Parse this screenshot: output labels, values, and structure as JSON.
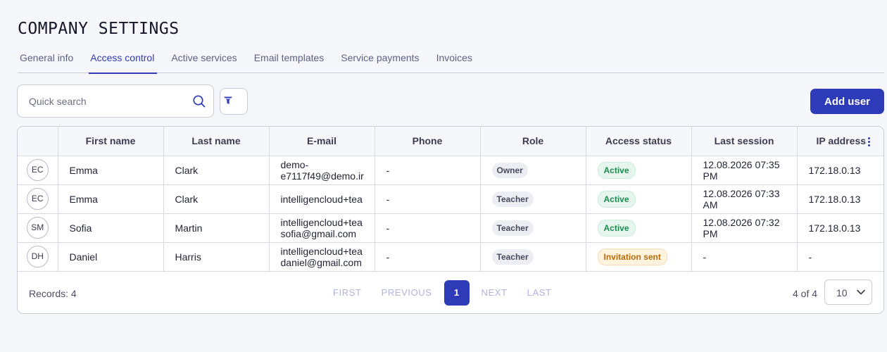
{
  "page_title": "COMPANY SETTINGS",
  "tabs": [
    {
      "label": "General info",
      "active": false
    },
    {
      "label": "Access control",
      "active": true
    },
    {
      "label": "Active services",
      "active": false
    },
    {
      "label": "Email templates",
      "active": false
    },
    {
      "label": "Service payments",
      "active": false
    },
    {
      "label": "Invoices",
      "active": false
    }
  ],
  "search": {
    "placeholder": "Quick search",
    "value": "",
    "icon": "search-icon"
  },
  "filter": {
    "icon": "filter-icon"
  },
  "add_user_label": "Add user",
  "accent_color": "#2e3bb8",
  "table": {
    "columns": [
      "",
      "First name",
      "Last name",
      "E-mail",
      "Phone",
      "Role",
      "Access status",
      "Last session",
      "IP address"
    ],
    "rows": [
      {
        "initials": "EC",
        "first": "Emma",
        "last": "Clark",
        "email_l1": "demo-",
        "email_l2": "e7117f49@demo.ir",
        "phone": "-",
        "role": "Owner",
        "status": "Active",
        "status_type": "active",
        "session_l1": "12.08.2026 07:35",
        "session_l2": "PM",
        "ip": "172.18.0.13"
      },
      {
        "initials": "EC",
        "first": "Emma",
        "last": "Clark",
        "email_l1": "intelligencloud+tea",
        "email_l2": "",
        "phone": "-",
        "role": "Teacher",
        "status": "Active",
        "status_type": "active",
        "session_l1": "12.08.2026 07:33",
        "session_l2": "AM",
        "ip": "172.18.0.13"
      },
      {
        "initials": "SM",
        "first": "Sofia",
        "last": "Martin",
        "email_l1": "intelligencloud+tea",
        "email_l2": "sofia@gmail.com",
        "phone": "-",
        "role": "Teacher",
        "status": "Active",
        "status_type": "active",
        "session_l1": "12.08.2026 07:32",
        "session_l2": "PM",
        "ip": "172.18.0.13"
      },
      {
        "initials": "DH",
        "first": "Daniel",
        "last": "Harris",
        "email_l1": "intelligencloud+tea",
        "email_l2": "daniel@gmail.com",
        "phone": "-",
        "role": "Teacher",
        "status": "Invitation sent",
        "status_type": "invite",
        "session_l1": "-",
        "session_l2": "",
        "ip": "-"
      }
    ]
  },
  "footer": {
    "records_label": "Records: 4",
    "pager": {
      "first": "FIRST",
      "previous": "PREVIOUS",
      "current_page": "1",
      "next": "NEXT",
      "last": "LAST"
    },
    "count_label": "4 of 4",
    "page_size": "10"
  }
}
